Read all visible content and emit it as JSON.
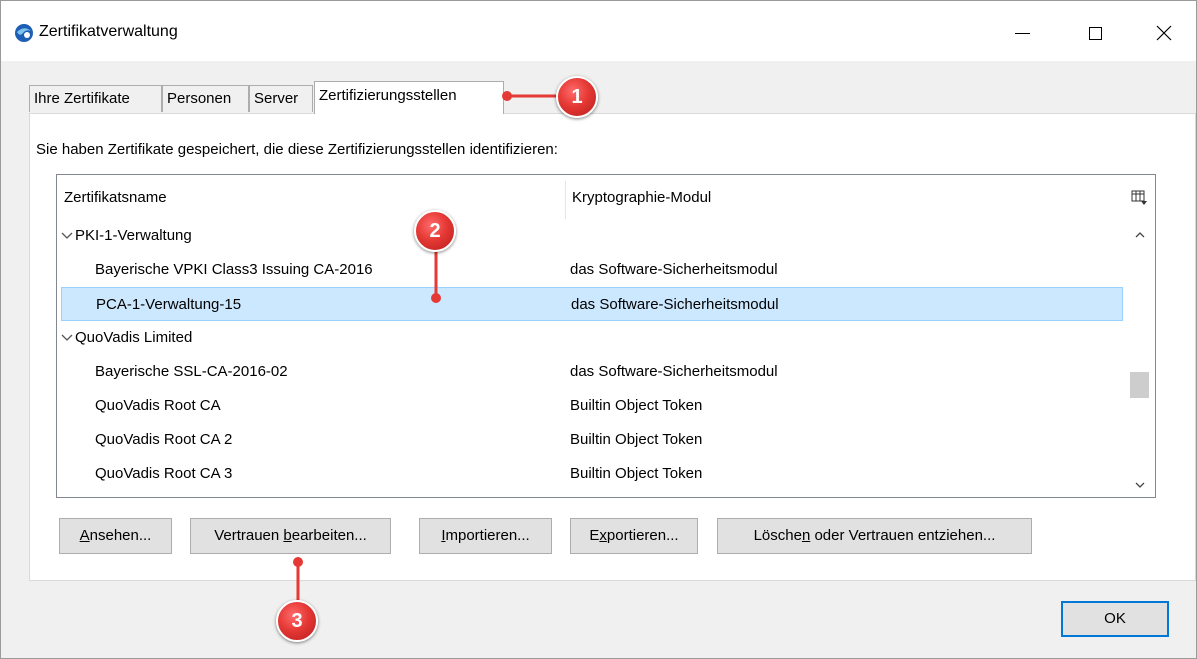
{
  "window": {
    "title": "Zertifikatverwaltung",
    "app_icon": "thunderbird-icon"
  },
  "tabs": [
    {
      "label": "Ihre Zertifikate"
    },
    {
      "label": "Personen"
    },
    {
      "label": "Server"
    },
    {
      "label": "Zertifizierungsstellen",
      "active": true
    }
  ],
  "panel": {
    "intro": "Sie haben Zertifikate gespeichert, die diese Zertifizierungsstellen identifizieren:"
  },
  "table": {
    "columns": [
      "Zertifikatsname",
      "Kryptographie-Modul"
    ],
    "rows": [
      {
        "type": "group",
        "name": "PKI-1-Verwaltung",
        "module": ""
      },
      {
        "type": "item",
        "name": "Bayerische VPKI Class3 Issuing CA-2016",
        "module": "das Software-Sicherheitsmodul"
      },
      {
        "type": "item",
        "name": "PCA-1-Verwaltung-15",
        "module": "das Software-Sicherheitsmodul",
        "selected": true
      },
      {
        "type": "group",
        "name": "QuoVadis Limited",
        "module": ""
      },
      {
        "type": "item",
        "name": "Bayerische SSL-CA-2016-02",
        "module": "das Software-Sicherheitsmodul"
      },
      {
        "type": "item",
        "name": "QuoVadis Root CA",
        "module": "Builtin Object Token"
      },
      {
        "type": "item",
        "name": "QuoVadis Root CA 2",
        "module": "Builtin Object Token"
      },
      {
        "type": "item",
        "name": "QuoVadis Root CA 3",
        "module": "Builtin Object Token"
      }
    ]
  },
  "buttons": {
    "view": {
      "before": "",
      "mnemonic": "A",
      "after": "nsehen..."
    },
    "edit_trust": {
      "before": "Vertrauen ",
      "mnemonic": "b",
      "after": "earbeiten..."
    },
    "import": {
      "before": "",
      "mnemonic": "I",
      "after": "mportieren..."
    },
    "export": {
      "before": "E",
      "mnemonic": "x",
      "after": "portieren..."
    },
    "delete": {
      "before": "Lösche",
      "mnemonic": "n",
      "after": " oder Vertrauen entziehen..."
    },
    "ok": "OK"
  },
  "markers": [
    "1",
    "2",
    "3"
  ],
  "colors": {
    "marker": "#e53935",
    "selection": "#cce8ff",
    "ok_border": "#0078d7"
  }
}
